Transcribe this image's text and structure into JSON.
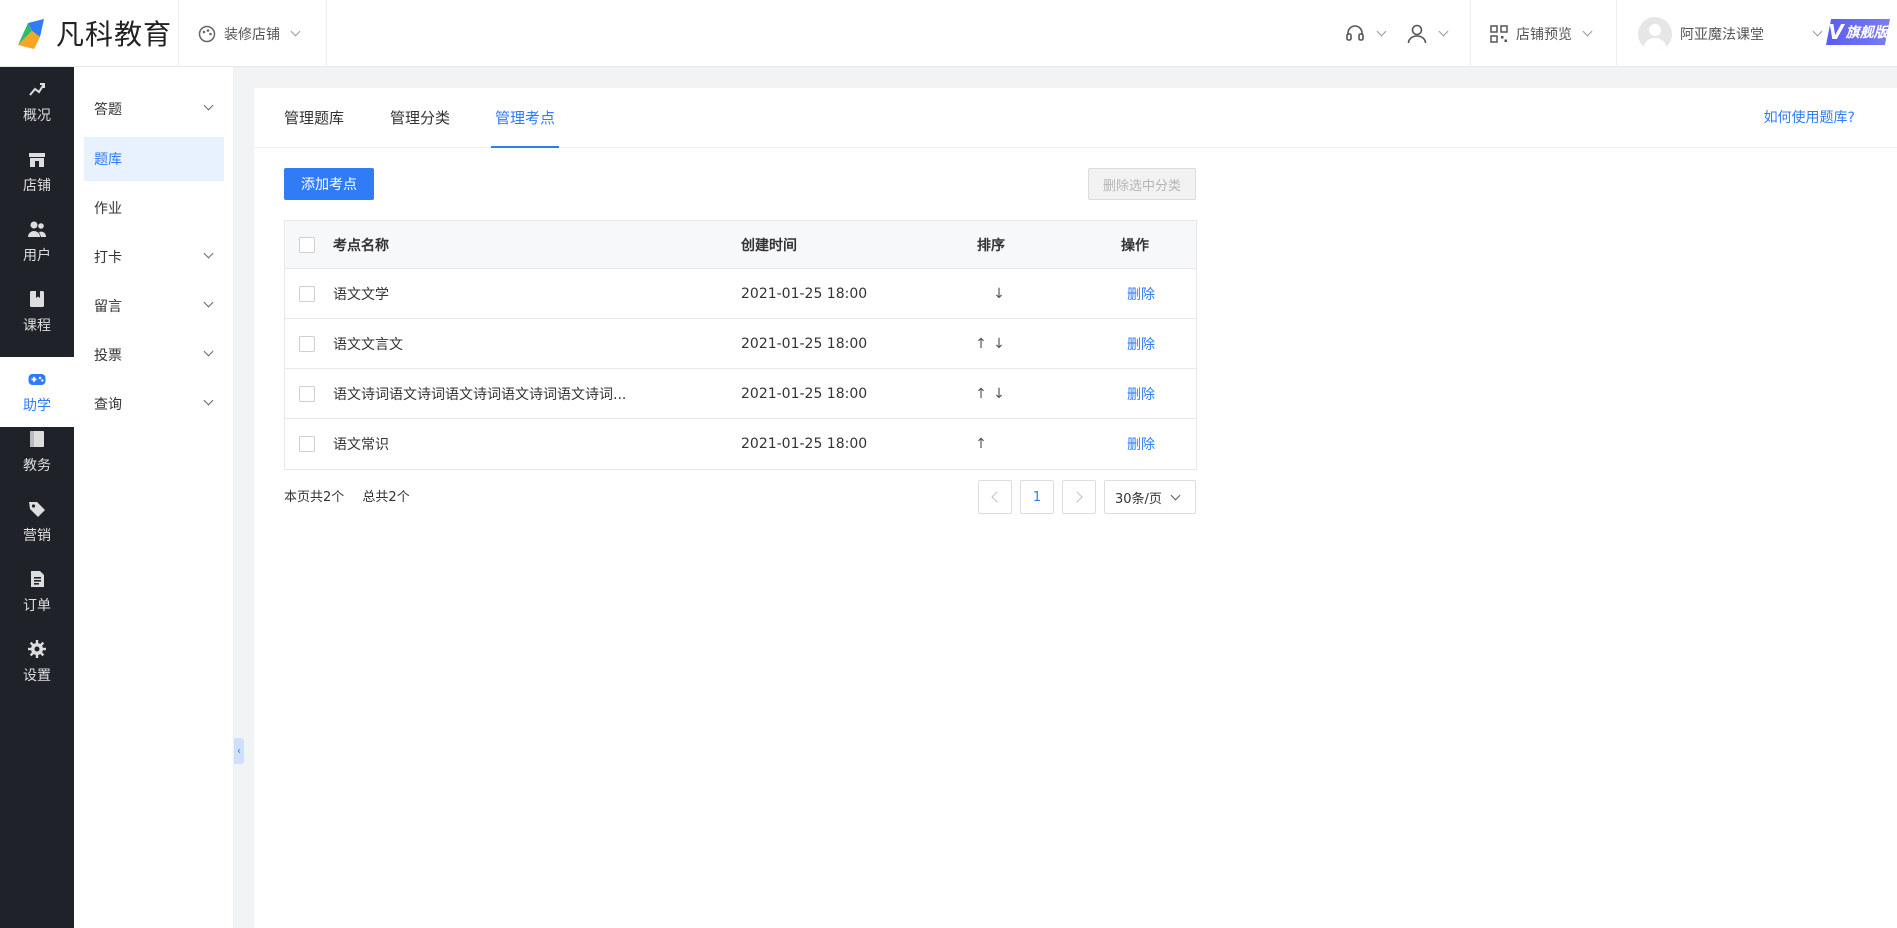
{
  "header": {
    "logo_text": "凡科教育",
    "decorate_label": "装修店铺",
    "store_preview_label": "店铺预览",
    "username": "阿亚魔法课堂",
    "badge_v": "V",
    "badge_label": "旗舰版"
  },
  "sidenav": {
    "items": [
      {
        "label": "概况",
        "icon": "chart-icon"
      },
      {
        "label": "店铺",
        "icon": "store-icon"
      },
      {
        "label": "用户",
        "icon": "users-icon"
      },
      {
        "label": "课程",
        "icon": "book-icon"
      },
      {
        "label": "助学",
        "icon": "gamepad-icon"
      },
      {
        "label": "教务",
        "icon": "notebook-icon"
      },
      {
        "label": "营销",
        "icon": "tag-icon"
      },
      {
        "label": "订单",
        "icon": "document-icon"
      },
      {
        "label": "设置",
        "icon": "gear-icon"
      }
    ],
    "active_index": 4
  },
  "submenu": {
    "items": [
      {
        "label": "答题",
        "expandable": true
      },
      {
        "label": "题库",
        "expandable": false,
        "active": true
      },
      {
        "label": "作业",
        "expandable": false
      },
      {
        "label": "打卡",
        "expandable": true
      },
      {
        "label": "留言",
        "expandable": true
      },
      {
        "label": "投票",
        "expandable": true
      },
      {
        "label": "查询",
        "expandable": true
      }
    ]
  },
  "tabs": [
    {
      "label": "管理题库"
    },
    {
      "label": "管理分类"
    },
    {
      "label": "管理考点",
      "active": true
    }
  ],
  "help_link": "如何使用题库?",
  "actions": {
    "add_label": "添加考点",
    "delete_selected_label": "删除选中分类"
  },
  "table": {
    "headers": {
      "name": "考点名称",
      "created": "创建时间",
      "sort": "排序",
      "ops": "操作"
    },
    "rows": [
      {
        "name": "语文文学",
        "created": "2021-01-25 18:00",
        "up": false,
        "down": true,
        "op": "删除"
      },
      {
        "name": "语文文言文",
        "created": "2021-01-25 18:00",
        "up": true,
        "down": true,
        "op": "删除"
      },
      {
        "name": "语文诗词语文诗词语文诗词语文诗词语文诗词...",
        "created": "2021-01-25 18:00",
        "up": true,
        "down": true,
        "op": "删除"
      },
      {
        "name": "语文常识",
        "created": "2021-01-25 18:00",
        "up": true,
        "down": false,
        "op": "删除"
      }
    ]
  },
  "pagination": {
    "page_count_text": "本页共2个",
    "total_text": "总共2个",
    "current_page": "1",
    "page_size": "30条/页"
  },
  "colors": {
    "accent": "#2f7cf6",
    "nav_bg": "#1f2329"
  }
}
